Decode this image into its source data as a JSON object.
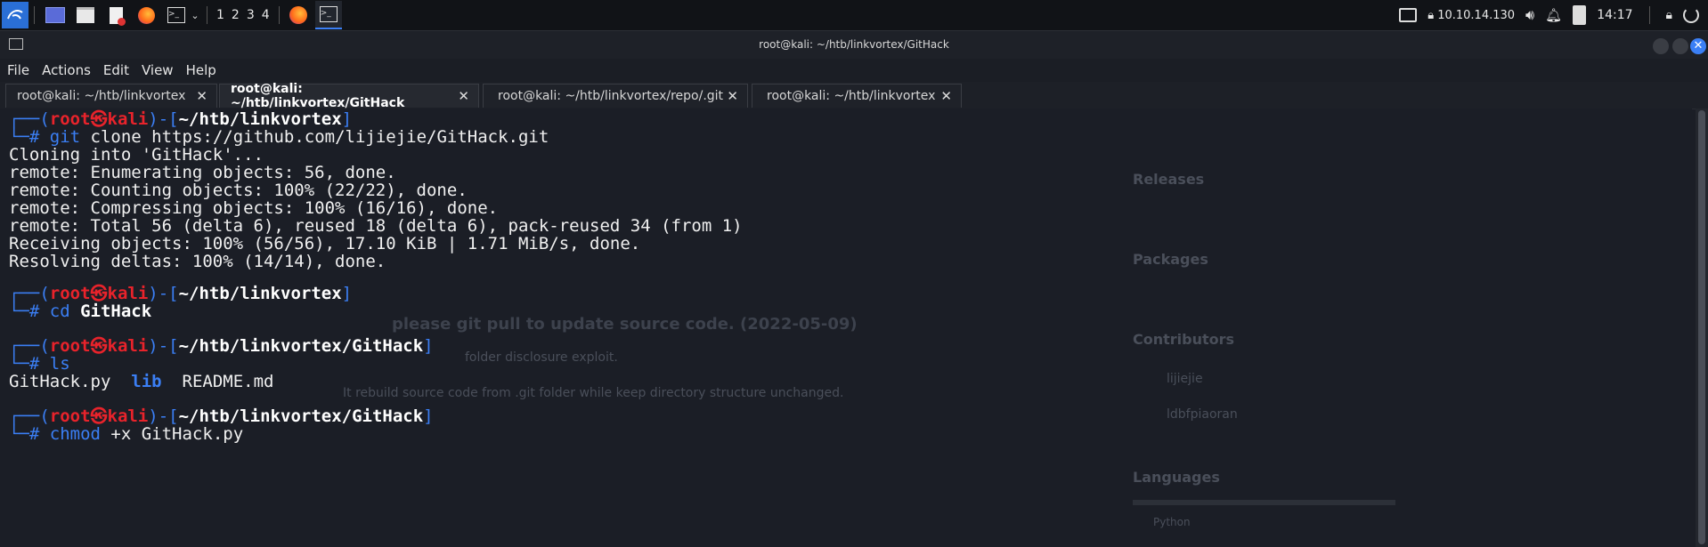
{
  "panel": {
    "workspaces": [
      "1",
      "2",
      "3",
      "4"
    ],
    "ip": "10.10.14.130",
    "clock": "14:17"
  },
  "window": {
    "title": "root@kali: ~/htb/linkvortex/GitHack"
  },
  "menu": [
    "File",
    "Actions",
    "Edit",
    "View",
    "Help"
  ],
  "tabs": [
    {
      "label": "root@kali: ~/htb/linkvortex",
      "close": "✕"
    },
    {
      "label": "root@kali: ~/htb/linkvortex/GitHack",
      "close": "✕"
    },
    {
      "label": "root@kali: ~/htb/linkvortex/repo/.git",
      "close": "✕"
    },
    {
      "label": "root@kali: ~/htb/linkvortex",
      "close": "✕"
    }
  ],
  "prompt": {
    "open": "┌──(",
    "user": "root㉿kali",
    "mid": ")-[",
    "close": "]",
    "hash": "└─#"
  },
  "blocks": [
    {
      "path": "~/htb/linkvortex",
      "cmd": "git",
      "args": " clone https://github.com/lijiejie/GitHack.git"
    },
    {
      "path": "~/htb/linkvortex",
      "cmd": "cd",
      "args": " GitHack"
    },
    {
      "path": "~/htb/linkvortex/GitHack",
      "cmd": "ls",
      "args": ""
    },
    {
      "path": "~/htb/linkvortex/GitHack",
      "cmd": "chmod",
      "args": " +x GitHack.py"
    }
  ],
  "output": {
    "clone": [
      "Cloning into 'GitHack'...",
      "remote: Enumerating objects: 56, done.",
      "remote: Counting objects: 100% (22/22), done.",
      "remote: Compressing objects: 100% (16/16), done.",
      "remote: Total 56 (delta 6), reused 18 (delta 6), pack-reused 34 (from 1)",
      "Receiving objects: 100% (56/56), 17.10 KiB | 1.71 MiB/s, done.",
      "Resolving deltas: 100% (14/14), done."
    ],
    "ls": {
      "file1": "GitHack.py",
      "dir": "lib",
      "file2": "README.md"
    }
  },
  "background_page": {
    "releases": "Releases",
    "packages": "Packages",
    "contributors": "Contributors",
    "languages": "Languages",
    "contrib1": "lijiejie",
    "contrib2": "ldbfpiaoran",
    "notice": "please git pull to update source code. (2022-05-09)",
    "line1": "folder disclosure exploit.",
    "line2": "It rebuild source code from .git folder while keep directory structure unchanged.",
    "lang": "Python"
  }
}
